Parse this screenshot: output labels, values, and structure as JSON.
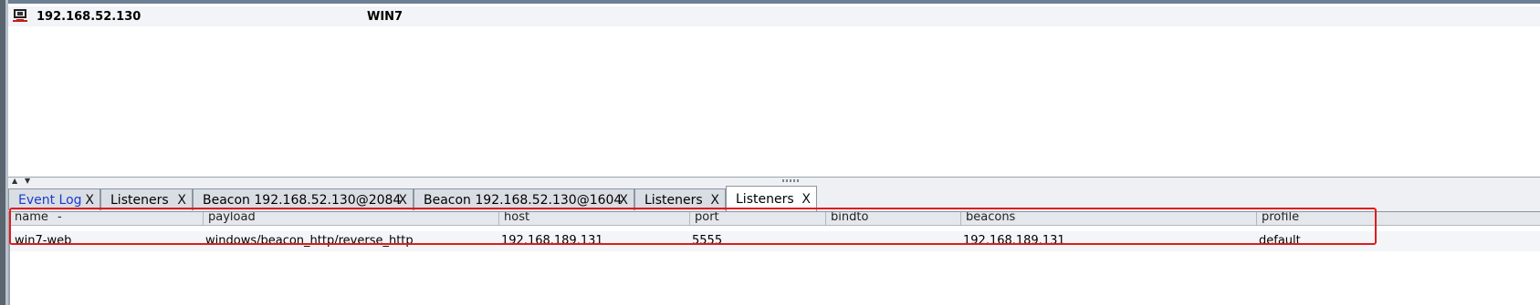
{
  "sessions": {
    "row": {
      "internal": "192.168.52.130",
      "computer": "WIN7",
      "icon": "computer-icon"
    }
  },
  "tabs": [
    {
      "label": "Event Log",
      "close": "X",
      "active": false,
      "link": true
    },
    {
      "label": "Listeners",
      "close": "X",
      "active": false
    },
    {
      "label": "Beacon 192.168.52.130@2084",
      "close": "X",
      "active": false
    },
    {
      "label": "Beacon 192.168.52.130@1604",
      "close": "X",
      "active": false
    },
    {
      "label": "Listeners",
      "close": "X",
      "active": false
    },
    {
      "label": "Listeners",
      "close": "X",
      "active": true
    }
  ],
  "listeners": {
    "columns": [
      "name",
      "payload",
      "host",
      "port",
      "bindto",
      "beacons",
      "profile"
    ],
    "sort_indicator": "-",
    "rows": [
      [
        "win7-web",
        "windows/beacon_http/reverse_http",
        "192.168.189.131",
        "5555",
        "",
        "192.168.189.131",
        "default"
      ]
    ]
  },
  "colors": {
    "highlight": "#e01b1b",
    "link": "#1a3bd1"
  }
}
